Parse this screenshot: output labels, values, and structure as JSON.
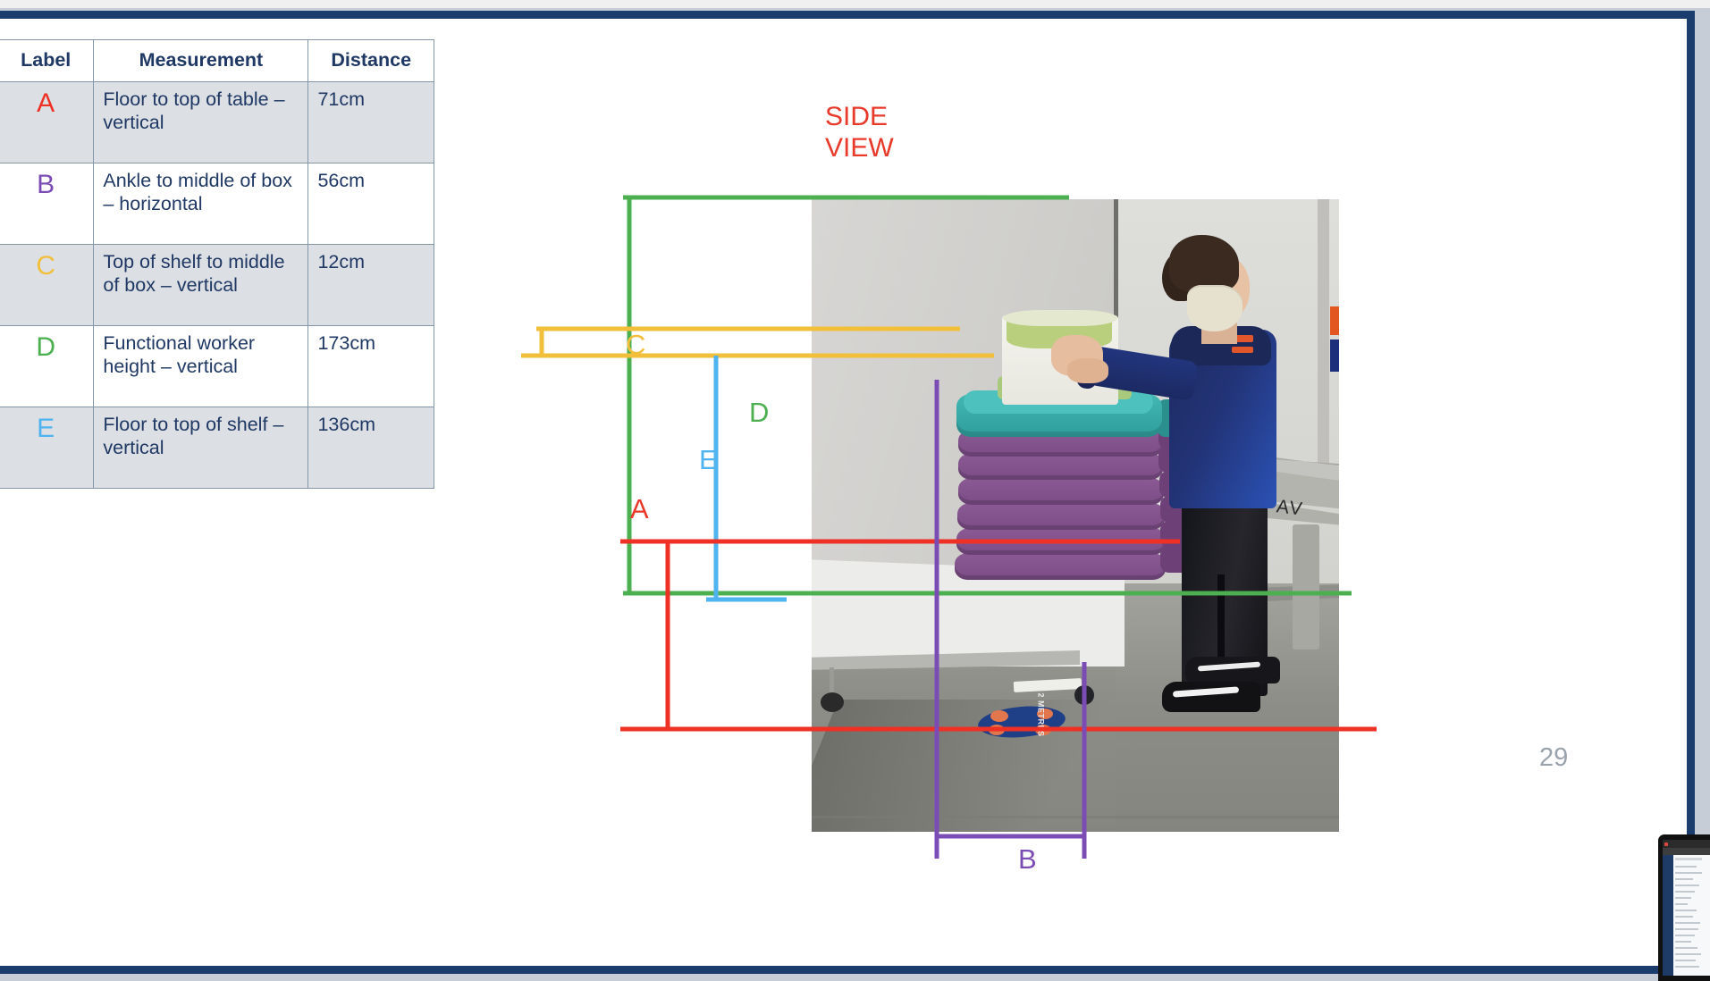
{
  "slide": {
    "page_number": "29",
    "side_view_title": "SIDE\nVIEW",
    "accent_border": "#1b3d6d"
  },
  "table": {
    "headers": [
      "Label",
      "Measurement",
      "Distance"
    ],
    "rows": [
      {
        "label": "A",
        "label_color": "#ee3124",
        "measurement": "Floor to top of table – vertical",
        "distance": "71cm"
      },
      {
        "label": "B",
        "label_color": "#7c4cb5",
        "measurement": "Ankle to middle of box – horizontal",
        "distance": "56cm"
      },
      {
        "label": "C",
        "label_color": "#f2bf3a",
        "measurement": "Top of shelf to middle of box – vertical",
        "distance": "12cm"
      },
      {
        "label": "D",
        "label_color": "#4caf50",
        "measurement": "Functional worker height – vertical",
        "distance": "173cm"
      },
      {
        "label": "E",
        "label_color": "#4eb3ef",
        "measurement": "Floor to top of shelf – vertical",
        "distance": "136cm"
      }
    ]
  },
  "diagram": {
    "labels": [
      {
        "id": "A",
        "text": "A",
        "color": "#e8392a"
      },
      {
        "id": "B",
        "text": "B",
        "color": "#7c4cb5"
      },
      {
        "id": "C",
        "text": "C",
        "color": "#f2bf3a"
      },
      {
        "id": "D",
        "text": "D",
        "color": "#4caf50"
      },
      {
        "id": "E",
        "text": "E",
        "color": "#4eb3ef"
      }
    ],
    "photo_text": {
      "trolley_label": "AV",
      "disc_label": "2 METRES"
    }
  },
  "webcam": {
    "present": true
  }
}
